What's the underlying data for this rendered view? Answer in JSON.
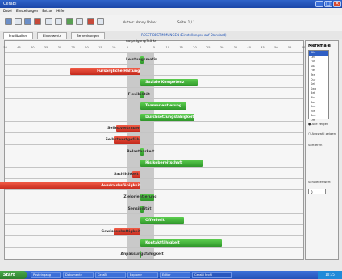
{
  "window": {
    "title": "CeraBi"
  },
  "menu": [
    "Datei",
    "Einstellungen",
    "Extras",
    "Hilfe"
  ],
  "toolbar": {
    "user_label": "Nutzer: Nanny Volker",
    "page_label": "Seite: 1 / 1"
  },
  "tabs": [
    {
      "label": "Profilbalken"
    },
    {
      "label": "Einzelwerte"
    },
    {
      "label": "Bemerkungen"
    }
  ],
  "tab_link": "RESET BESTIMMUNGEN (Einstellungen auf Standard)",
  "chart": {
    "scale_label": "Ausprägung/Stärke",
    "ticks": [
      "-50",
      "-45",
      "-40",
      "-35",
      "-30",
      "-25",
      "-20",
      "-15",
      "-10",
      "-5",
      "0",
      "5",
      "10",
      "15",
      "20",
      "25",
      "30",
      "35",
      "40",
      "45",
      "50",
      "55",
      "60"
    ]
  },
  "chart_data": {
    "type": "bar",
    "orientation": "horizontal",
    "xlim": [
      -50,
      60
    ],
    "neutral_band": [
      -5,
      5
    ],
    "categories": [
      "Leistungsmotiv",
      "Fürsorgliche Haltung",
      "Soziale Kompetenz",
      "Flexibilität",
      "Teamorientierung",
      "Durchsetzungsfähigkeit",
      "Selbstvertrauen",
      "Selbstwertgefühl",
      "Belastbarkeit",
      "Risikobereitschaft",
      "Sachlichkeit",
      "Ausdrucksfähigkeit",
      "Zielorientierung",
      "Sensibilität",
      "Offenheit",
      "Gewissenhaftigkeit",
      "Kontaktfähigkeit",
      "Anpassungsfähigkeit"
    ],
    "values": [
      1,
      -26,
      21,
      1,
      17,
      20,
      -9,
      -10,
      1,
      23,
      -3,
      -52,
      5,
      1,
      16,
      -10,
      30,
      0
    ],
    "colors": {
      "positive": "#3cb33a",
      "negative": "#d8321f"
    }
  },
  "panel": {
    "title": "Merkmale",
    "items": [
      "Alle",
      "Lei",
      "Für",
      "Soz",
      "Fle",
      "Tea",
      "Dur",
      "Sel",
      "Swg",
      "Bel",
      "Ris",
      "Sac",
      "Aus",
      "Zie",
      "Sen",
      "Off"
    ],
    "option_a": "Alle zeigen",
    "option_b": "Auswahl zeigen",
    "sort_label": "Sortieren",
    "filter_label": "Schwellenwert",
    "spin_value": "0"
  },
  "taskbar": {
    "start": "Start",
    "tasks": [
      "Posteingang",
      "Dokumente",
      "CeraBi",
      "Explorer",
      "Editor",
      "CeraBi Profil"
    ],
    "clock": "10:35"
  }
}
